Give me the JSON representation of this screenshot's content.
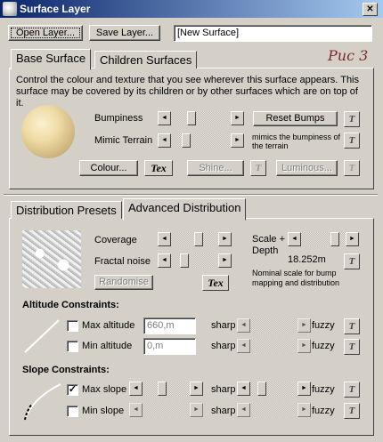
{
  "window": {
    "title": "Surface Layer",
    "close": "✕"
  },
  "top": {
    "open_label": "Open Layer...",
    "save_label": "Save Layer...",
    "name_value": "[New Surface]",
    "annotation": "Рис 3"
  },
  "tabs1": {
    "active": "Base Surface",
    "other": "Children Surfaces"
  },
  "base": {
    "description": "Control the colour and texture that you see wherever this surface appears. This surface may be covered by its children or by other surfaces which are on top of it.",
    "bumpiness_label": "Bumpiness",
    "bumpiness_level": 0.3,
    "reset_bumps": "Reset Bumps",
    "mimic_label": "Mimic Terrain",
    "mimic_level": 0.2,
    "mimic_note": "mimics the bumpiness of the terrain",
    "colour_btn": "Colour...",
    "tex_btn": "Tex",
    "shine_btn": "Shine...",
    "luminous_btn": "Luminous..."
  },
  "tabs2": {
    "other": "Distribution Presets",
    "active": "Advanced Distribution"
  },
  "dist": {
    "coverage_label": "Coverage",
    "fractal_label": "Fractal noise",
    "randomise_btn": "Randomise",
    "tex_btn": "Tex",
    "scale_label": "Scale + Depth",
    "scale_value": "18.252m",
    "scale_note": "Nominal scale for bump mapping and distribution"
  },
  "altitude": {
    "heading": "Altitude Constraints:",
    "max_label": "Max altitude",
    "max_value": "660,m",
    "min_label": "Min altitude",
    "min_value": "0,m",
    "sharp": "sharp",
    "fuzzy": "fuzzy"
  },
  "slope": {
    "heading": "Slope Constraints:",
    "max_label": "Max slope",
    "max_checked": "✓",
    "min_label": "Min slope",
    "sharp": "sharp",
    "fuzzy": "fuzzy"
  },
  "icons": {
    "left": "◄",
    "right": "►",
    "t": "T"
  }
}
